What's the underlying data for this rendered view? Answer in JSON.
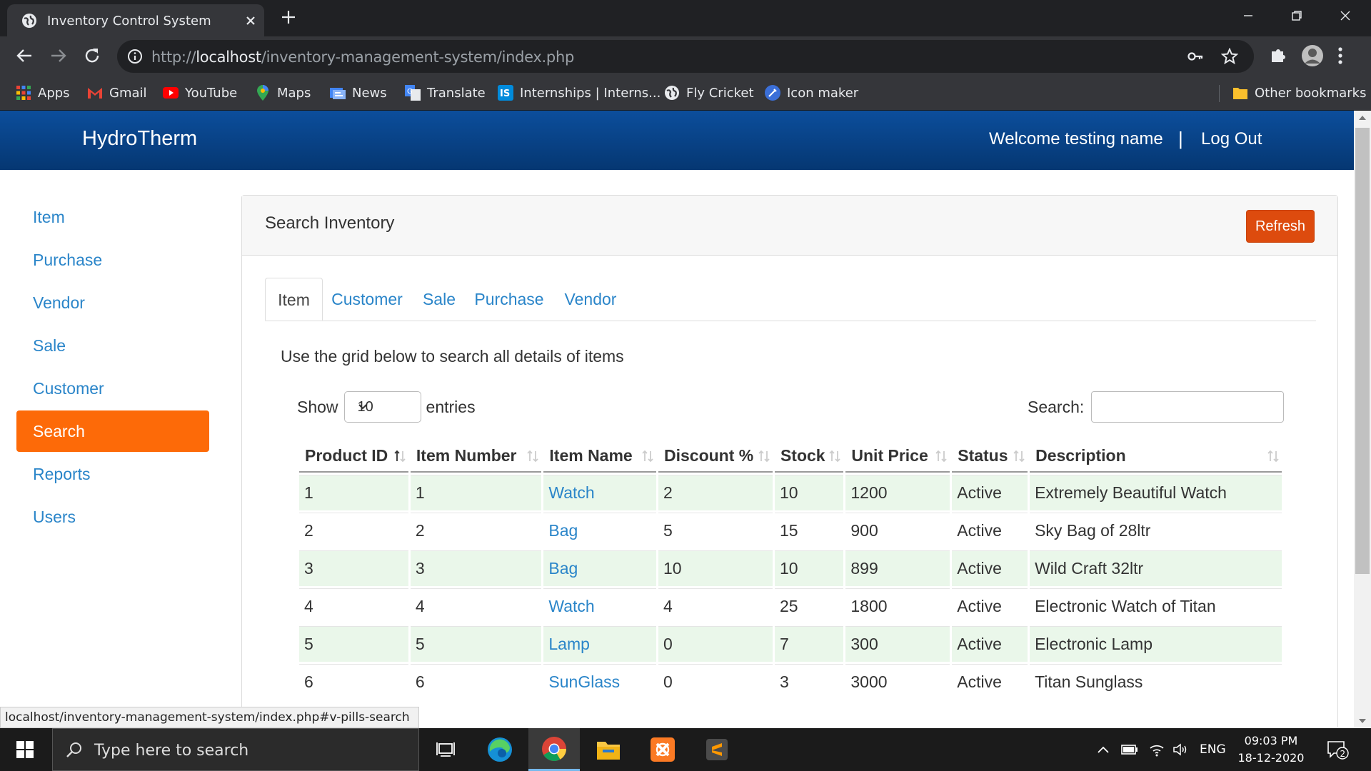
{
  "browser": {
    "tab_title": "Inventory Control System",
    "url_scheme": "http://",
    "url_host": "localhost",
    "url_path": "/inventory-management-system/index.php",
    "bookmarks": [
      {
        "label": "Apps",
        "icon": "apps-grid-icon"
      },
      {
        "label": "Gmail",
        "icon": "gmail-icon"
      },
      {
        "label": "YouTube",
        "icon": "youtube-icon"
      },
      {
        "label": "Maps",
        "icon": "maps-icon"
      },
      {
        "label": "News",
        "icon": "news-icon"
      },
      {
        "label": "Translate",
        "icon": "translate-icon"
      },
      {
        "label": "Internships | Interns...",
        "icon": "internshala-icon"
      },
      {
        "label": "Fly Cricket",
        "icon": "globe-icon"
      },
      {
        "label": "Icon maker",
        "icon": "icon-maker-icon"
      }
    ],
    "other_bookmarks": "Other bookmarks",
    "status_url": "localhost/inventory-management-system/index.php#v-pills-search"
  },
  "app": {
    "brand": "HydroTherm",
    "welcome": "Welcome testing name",
    "divider": "|",
    "logout": "Log Out"
  },
  "sidebar": {
    "items": [
      {
        "label": "Item",
        "active": false
      },
      {
        "label": "Purchase",
        "active": false
      },
      {
        "label": "Vendor",
        "active": false
      },
      {
        "label": "Sale",
        "active": false
      },
      {
        "label": "Customer",
        "active": false
      },
      {
        "label": "Search",
        "active": true
      },
      {
        "label": "Reports",
        "active": false
      },
      {
        "label": "Users",
        "active": false
      }
    ]
  },
  "main": {
    "title": "Search Inventory",
    "refresh_label": "Refresh",
    "tabs": [
      "Item",
      "Customer",
      "Sale",
      "Purchase",
      "Vendor"
    ],
    "active_tab": "Item",
    "intro": "Use the grid below to search all details of items",
    "show_label": "Show",
    "entries_value": "10",
    "entries_label": "entries",
    "search_label": "Search:",
    "columns": [
      "Product ID",
      "Item Number",
      "Item Name",
      "Discount %",
      "Stock",
      "Unit Price",
      "Status",
      "Description"
    ],
    "rows": [
      [
        "1",
        "1",
        "Watch",
        "2",
        "10",
        "1200",
        "Active",
        "Extremely Beautiful Watch"
      ],
      [
        "2",
        "2",
        "Bag",
        "5",
        "15",
        "900",
        "Active",
        "Sky Bag of 28ltr"
      ],
      [
        "3",
        "3",
        "Bag",
        "10",
        "10",
        "899",
        "Active",
        "Wild Craft 32ltr"
      ],
      [
        "4",
        "4",
        "Watch",
        "4",
        "25",
        "1800",
        "Active",
        "Electronic Watch of Titan"
      ],
      [
        "5",
        "5",
        "Lamp",
        "0",
        "7",
        "300",
        "Active",
        "Electronic Lamp"
      ],
      [
        "6",
        "6",
        "SunGlass",
        "0",
        "3",
        "3000",
        "Active",
        "Titan Sunglass"
      ]
    ]
  },
  "taskbar": {
    "search_placeholder": "Type here to search",
    "language": "ENG",
    "time": "09:03 PM",
    "date": "18-12-2020",
    "notification_count": "2"
  },
  "colors": {
    "navbar": "#0c4e9c",
    "accent_orange": "#fd6a08",
    "refresh_button": "#dd4b0e",
    "link_blue": "#2a85c9",
    "row_stripe": "#eaf7ea"
  }
}
